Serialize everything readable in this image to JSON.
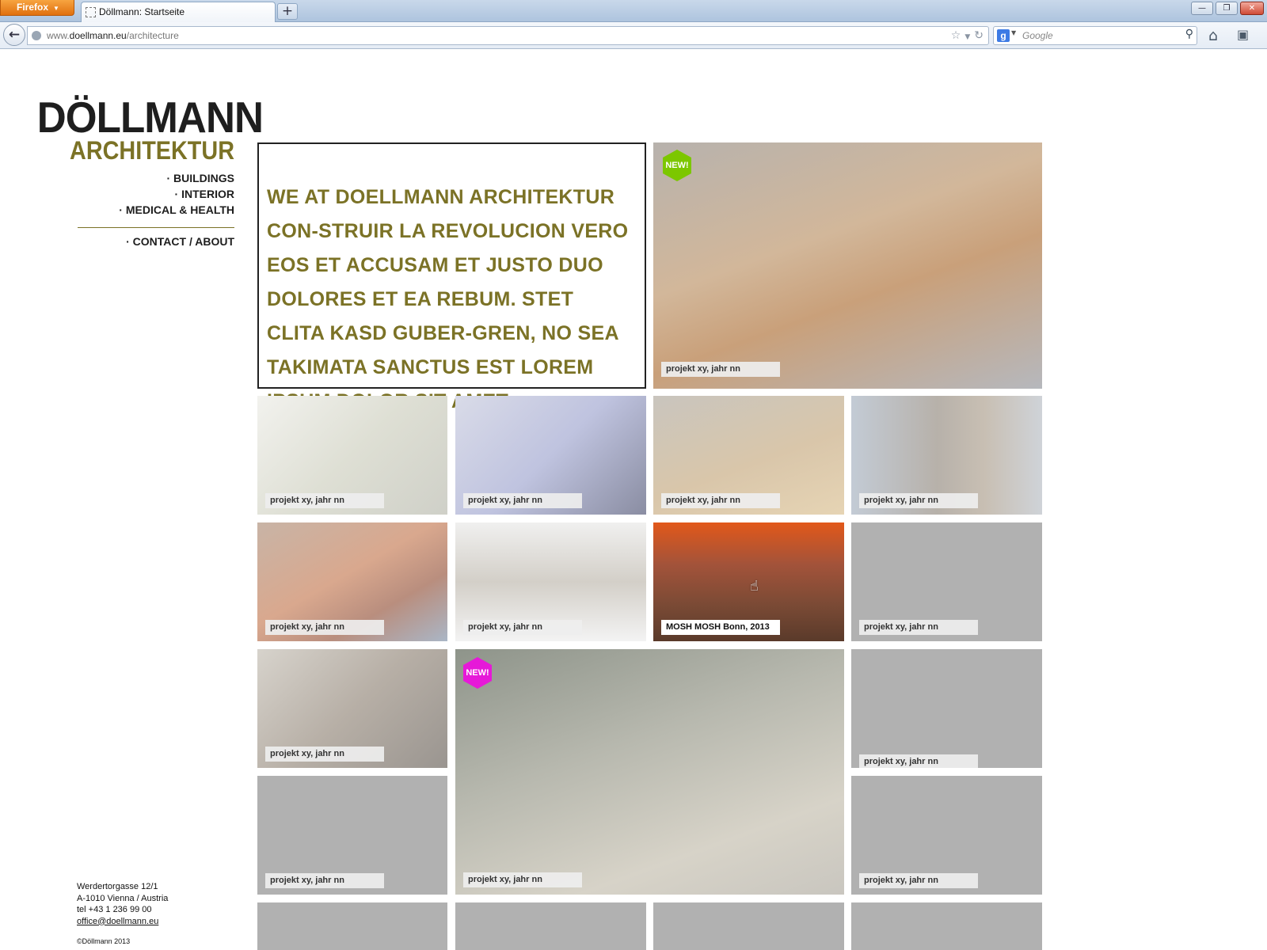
{
  "browser": {
    "app_button": "Firefox",
    "tab_title": "Döllmann: Startseite",
    "new_tab": "+",
    "url_prefix": "www.",
    "url_domain": "doellmann.eu",
    "url_path": "/architecture",
    "search_engine": "g",
    "search_placeholder": "Google"
  },
  "site": {
    "logo_main": "DÖLLMANN",
    "logo_sub": "ARCHITEKTUR",
    "accent_color": "#7b7226",
    "nav": [
      "· BUILDINGS",
      "· INTERIOR",
      "· MEDICAL & HEALTH"
    ],
    "nav_secondary": "· CONTACT / ABOUT",
    "address": {
      "street": "Werdertorgasse 12/1",
      "city": "A-1010 Vienna / Austria",
      "tel": "tel +43 1 236 99 00",
      "email": "office@doellmann.eu"
    },
    "copyright": "©Döllmann 2013"
  },
  "intro_text": "WE AT DOELLMANN ARCHITEKTUR CON-STRUIR LA REVOLUCION VERO EOS ET ACCUSAM ET JUSTO DUO DOLORES ET EA REBUM. STET CLITA KASD GUBER-GREN, NO SEA TAKIMATA SANCTUS EST LOREM IPSUM DOLOR SIT AMET.",
  "projects": [
    {
      "caption": "projekt xy, jahr nn",
      "badge": "NEW!",
      "badge_color": "#7cc700"
    },
    {
      "caption": "projekt xy, jahr nn"
    },
    {
      "caption": "projekt xy, jahr nn"
    },
    {
      "caption": "projekt xy, jahr nn"
    },
    {
      "caption": "projekt xy, jahr nn"
    },
    {
      "caption": "projekt xy, jahr nn"
    },
    {
      "caption": "projekt xy, jahr nn"
    },
    {
      "caption": "MOSH MOSH Bonn, 2013"
    },
    {
      "caption": "projekt xy, jahr nn"
    },
    {
      "caption": "projekt xy, jahr nn"
    },
    {
      "caption": "projekt xy, jahr nn",
      "badge": "NEW!",
      "badge_color": "#e619d8"
    },
    {
      "caption": "projekt xy, jahr nn"
    },
    {
      "caption": "projekt xy, jahr nn"
    },
    {
      "caption": "projekt xy, jahr nn"
    }
  ]
}
